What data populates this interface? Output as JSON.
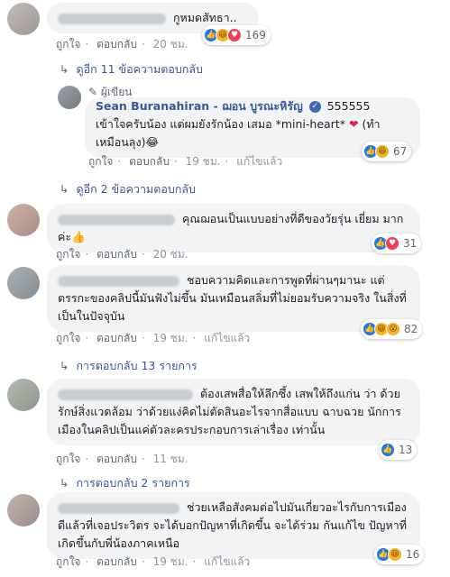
{
  "common": {
    "like": "ถูกใจ",
    "reply": "ตอบกลับ",
    "edited": "แก้ไขแล้ว",
    "sep": "·"
  },
  "comments": [
    {
      "text": "กูหมดสัทธา..",
      "time": "20 ชม.",
      "reactions": [
        "like",
        "haha",
        "love"
      ],
      "count": "169"
    },
    {
      "text": "คุณฌอนเป็นแบบอย่างที่ดีของวัยรุ่น เยี่ยม มากค่ะ👍",
      "time": "20 ชม.",
      "reactions": [
        "like",
        "love"
      ],
      "count": "31"
    },
    {
      "text": "ชอบความคิดและการพูดที่ผ่านๆมานะ แต่ ตรรกะของคลิปนี้มันฟังไม่ขึ้น มันเหมือนสลิ่มที่ไม่ยอมรับความจริง ในสิ่งที่เป็นในปัจจุบัน",
      "time": "19 ชม.",
      "edited": true,
      "reactions": [
        "like",
        "haha",
        "wow"
      ],
      "count": "82"
    },
    {
      "text": "ต้องเสพสื่อให้ลึกซึ้ง เสพให้ถึงแก่น ว่า ด้วยรักษ์สิ่งแวดล้อม ว่าด้วยแง่คิดไม่ตัดสินอะไรจากสื่อแบบ ฉาบฉวย นักการเมืองในคลิปเป็นแค่ตัวละครประกอบการเล่าเรื่อง เท่านั้น",
      "time": "11 ชม.",
      "reactions": [
        "like"
      ],
      "count": "13"
    },
    {
      "text": "ช่วยเหลือสังคมต่อไปมันเกี่ยวอะไรกับการเมือง ดีแล้วที่เจอประวิตร จะได้บอกปัญหาที่เกิดขึ้น จะได้ร่วม กันแก้ไข ปัญหาที่เกิดขึ้นกับพี่น้องภาคเหนือ",
      "time": "19 ชม.",
      "edited": true,
      "reactions": [
        "like",
        "haha"
      ],
      "count": "16"
    }
  ],
  "author_reply": {
    "tag": "ผู้เขียน",
    "name": "Sean Buranahiran - ฌอน บูรณะหิรัญ",
    "number": "555555",
    "text": "เข้าใจครับน้อง แต่ผมยังรักน้อง เสมอ *mini-heart*",
    "heart": "❤",
    "text_after": "(ทำ เหมือนลุง)😂",
    "time": "19 ชม.",
    "edited": true,
    "reactions": [
      "like",
      "haha"
    ],
    "count": "67"
  },
  "reply_links": [
    {
      "label": "ดูอีก 11 ข้อความตอบกลับ"
    },
    {
      "label": "ดูอีก 2 ข้อความตอบกลับ"
    },
    {
      "label": "การตอบกลับ 13 รายการ"
    },
    {
      "label": "การตอบกลับ 2 รายการ"
    }
  ],
  "icons": {
    "reply_arrow": "reply-arrow-icon",
    "verified": "verified-badge-icon",
    "pencil": "pencil-icon"
  },
  "colors": {
    "link": "#385898",
    "bubble": "#f2f3f5",
    "like": "#1877f2",
    "love": "#f33e58",
    "haha": "#f7b125"
  }
}
